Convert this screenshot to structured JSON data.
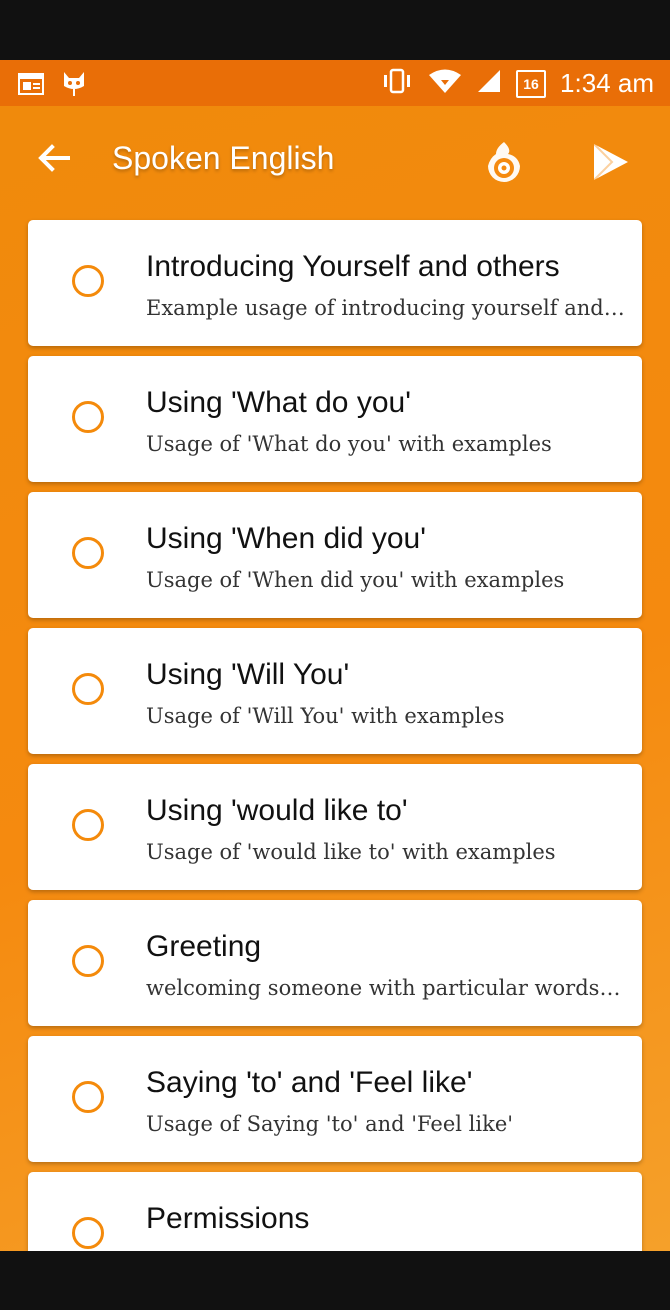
{
  "status_bar": {
    "time": "1:34 am",
    "battery_level": "16",
    "icons": [
      "calendar-icon",
      "cat-icon",
      "vibrate-icon",
      "wifi-icon",
      "signal-icon",
      "battery-icon"
    ]
  },
  "appbar": {
    "title": "Spoken English",
    "icons": [
      "back-arrow-icon",
      "fire-disc-icon",
      "play-store-icon"
    ]
  },
  "lessons": [
    {
      "title": "Introducing Yourself and others",
      "subtitle": "Example usage of introducing yourself and others"
    },
    {
      "title": "Using 'What do you'",
      "subtitle": "Usage of 'What do you' with examples"
    },
    {
      "title": "Using 'When did you'",
      "subtitle": "Usage of 'When did you' with examples"
    },
    {
      "title": "Using 'Will You'",
      "subtitle": "Usage of 'Will You' with examples"
    },
    {
      "title": "Using 'would like to'",
      "subtitle": "Usage of 'would like to' with examples"
    },
    {
      "title": "Greeting",
      "subtitle": "welcoming someone with particular words or gestures"
    },
    {
      "title": "Saying 'to' and 'Feel like'",
      "subtitle": "Usage of Saying 'to' and 'Feel like'"
    },
    {
      "title": "Permissions",
      "subtitle": ""
    }
  ],
  "colors": {
    "accent": "#f48a0b",
    "status_bar": "#e96e07",
    "background": "#f58a0f"
  }
}
